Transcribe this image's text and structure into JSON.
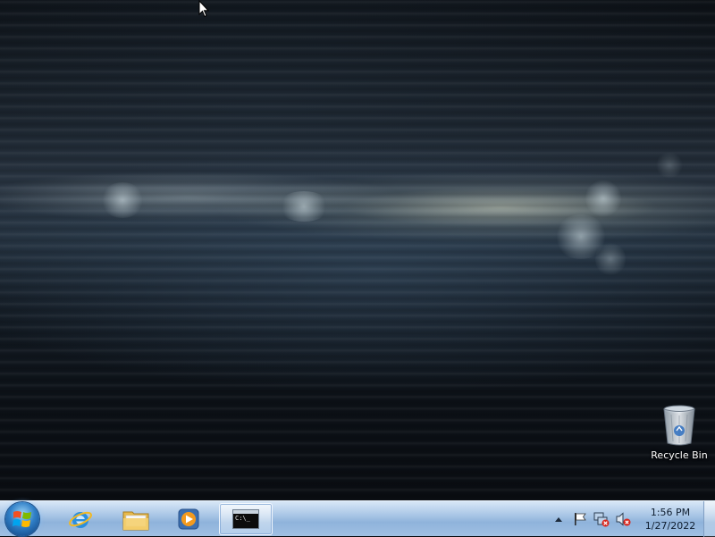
{
  "desktop": {
    "icons": [
      {
        "label": "Recycle Bin",
        "icon": "recycle-bin-icon"
      }
    ]
  },
  "taskbar": {
    "start_icon": "windows-logo-icon",
    "pinned": [
      {
        "name": "Internet Explorer",
        "icon": "internet-explorer-icon"
      },
      {
        "name": "Windows Explorer",
        "icon": "folder-icon"
      },
      {
        "name": "Windows Media Player",
        "icon": "media-player-icon"
      },
      {
        "name": "Command Prompt",
        "icon": "command-prompt-icon",
        "active": true,
        "glyph": "C:\\_"
      }
    ],
    "tray": {
      "icons": [
        "show-hidden-icons-arrow",
        "action-center-flag-icon",
        "network-disconnected-icon",
        "volume-muted-icon"
      ]
    },
    "clock": {
      "time": "1:56 PM",
      "date": "1/27/2022"
    }
  },
  "colors": {
    "taskbar_top": "#d8e7f7",
    "taskbar_bottom": "#8fb3db",
    "desktop_bg": "#0b0f14"
  }
}
